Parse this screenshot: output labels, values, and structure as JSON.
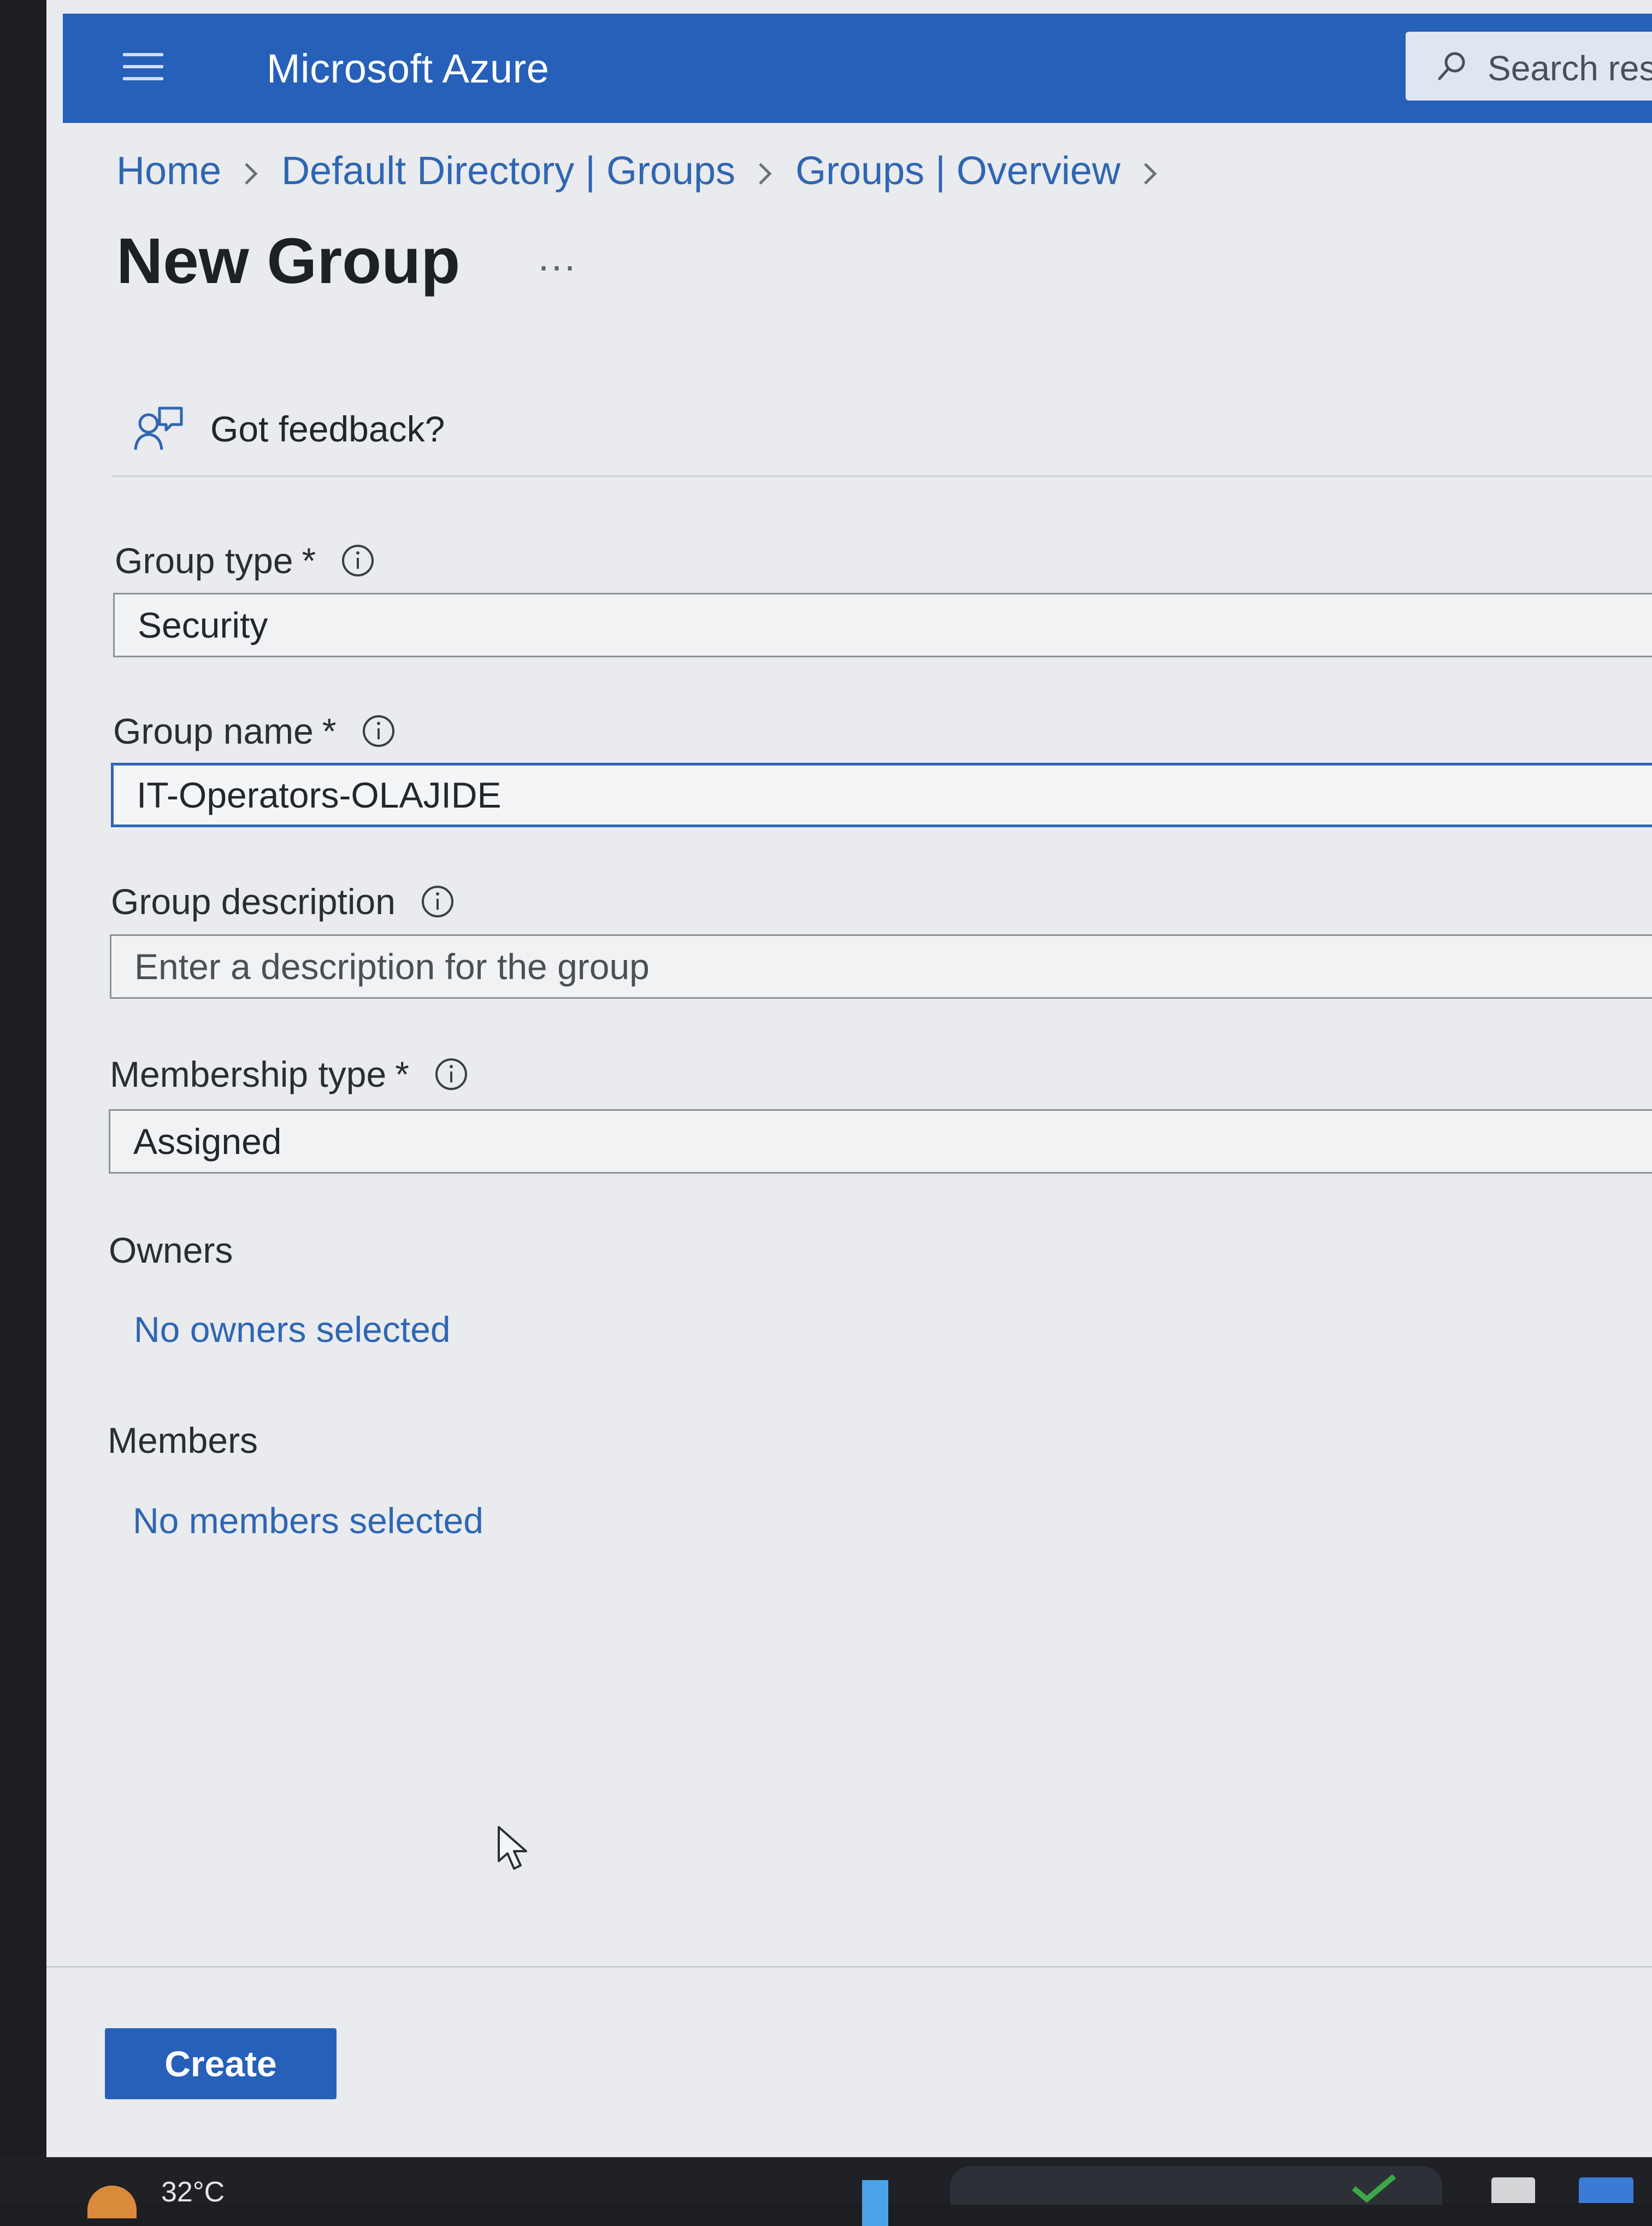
{
  "header": {
    "brand": "Microsoft Azure",
    "search_placeholder": "Search reso",
    "menu_icon": "hamburger-menu-icon"
  },
  "breadcrumb": {
    "items": [
      "Home",
      "Default Directory | Groups",
      "Groups | Overview"
    ]
  },
  "page": {
    "title": "New Group",
    "more": "..."
  },
  "feedback": {
    "label": "Got feedback?",
    "icon": "feedback-icon"
  },
  "form": {
    "group_type": {
      "label": "Group type",
      "required": "*",
      "value": "Security"
    },
    "group_name": {
      "label": "Group name",
      "required": "*",
      "value": "IT-Operators-OLAJIDE"
    },
    "group_description": {
      "label": "Group description",
      "placeholder": "Enter a description for the group"
    },
    "membership_type": {
      "label": "Membership type",
      "required": "*",
      "value": "Assigned"
    },
    "owners": {
      "label": "Owners",
      "link": "No owners selected"
    },
    "members": {
      "label": "Members",
      "link": "No members selected"
    }
  },
  "actions": {
    "create_label": "Create"
  },
  "taskbar": {
    "temperature": "32°C"
  },
  "colors": {
    "header_bg": "#2660b8",
    "link": "#2f66b3",
    "page_bg": "#e9ebee",
    "button_bg": "#2660b8"
  }
}
